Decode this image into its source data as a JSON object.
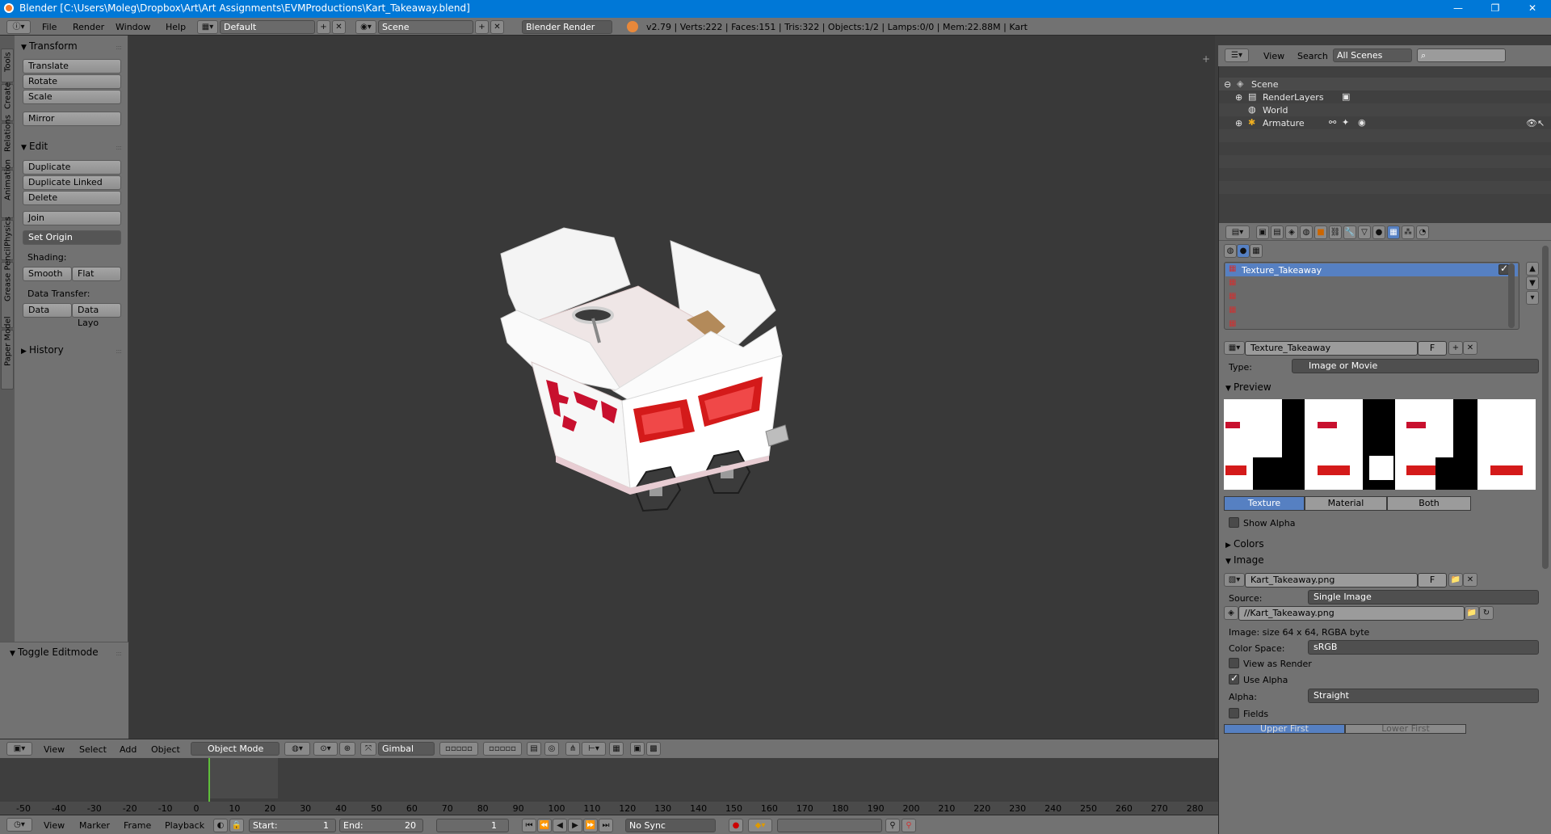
{
  "window": {
    "title": "Blender [C:\\Users\\Moleg\\Dropbox\\Art\\Art Assignments\\EVMProductions\\Kart_Takeaway.blend]",
    "minimize": "—",
    "maximize": "❐",
    "close": "✕"
  },
  "info_header": {
    "menus": [
      "File",
      "Render",
      "Window",
      "Help"
    ],
    "layout": "Default",
    "scene": "Scene",
    "engine": "Blender Render",
    "stats": "v2.79 | Verts:222 | Faces:151 | Tris:322 | Objects:1/2 | Lamps:0/0 | Mem:22.88M | Kart"
  },
  "tool_tabs": [
    "Tools",
    "Create",
    "Relations",
    "Animation",
    "Physics",
    "Grease Pencil",
    "Paper Model"
  ],
  "tool_shelf": {
    "transform_header": "Transform",
    "translate": "Translate",
    "rotate": "Rotate",
    "scale": "Scale",
    "mirror": "Mirror",
    "edit_header": "Edit",
    "duplicate": "Duplicate",
    "duplicate_linked": "Duplicate Linked",
    "delete": "Delete",
    "join": "Join",
    "set_origin": "Set Origin",
    "shading_label": "Shading:",
    "smooth": "Smooth",
    "flat": "Flat",
    "data_transfer_label": "Data Transfer:",
    "data": "Data",
    "data_layout": "Data Layo",
    "history_header": "History",
    "toggle_editmode": "Toggle Editmode"
  },
  "viewport_header": {
    "menus": [
      "View",
      "Select",
      "Add",
      "Object"
    ],
    "mode": "Object Mode",
    "orientation": "Gimbal"
  },
  "timeline": {
    "ticks": [
      "-50",
      "-40",
      "-30",
      "-20",
      "-10",
      "0",
      "10",
      "20",
      "30",
      "40",
      "50",
      "60",
      "70",
      "80",
      "90",
      "100",
      "110",
      "120",
      "130",
      "140",
      "150",
      "160",
      "170",
      "180",
      "190",
      "200",
      "210",
      "220",
      "230",
      "240",
      "250",
      "260",
      "270",
      "280"
    ],
    "current_frame": 0
  },
  "timeline_header": {
    "menus": [
      "View",
      "Marker",
      "Frame",
      "Playback"
    ],
    "start_label": "Start:",
    "start_value": "1",
    "end_label": "End:",
    "end_value": "20",
    "current": "1",
    "sync": "No Sync"
  },
  "outliner": {
    "menus": [
      "View",
      "Search"
    ],
    "filter": "All Scenes",
    "items": [
      {
        "label": "Scene"
      },
      {
        "label": "RenderLayers"
      },
      {
        "label": "World"
      },
      {
        "label": "Armature"
      }
    ]
  },
  "properties": {
    "texture_slot_active": "Texture_Takeaway",
    "texture_name": "Texture_Takeaway",
    "type_label": "Type:",
    "type_value": "Image or Movie",
    "preview_header": "Preview",
    "preview_tabs": [
      "Texture",
      "Material",
      "Both"
    ],
    "show_alpha": "Show Alpha",
    "colors_header": "Colors",
    "image_header": "Image",
    "image_name": "Kart_Takeaway.png",
    "source_label": "Source:",
    "source_value": "Single Image",
    "filepath": "//Kart_Takeaway.png",
    "image_info": "Image: size 64 x 64, RGBA byte",
    "color_space_label": "Color Space:",
    "color_space_value": "sRGB",
    "view_as_render": "View as Render",
    "use_alpha": "Use Alpha",
    "alpha_label": "Alpha:",
    "alpha_value": "Straight",
    "fields": "Fields",
    "upper_first": "Upper First",
    "lower_first": "Lower First",
    "fake_user": "F"
  },
  "colors": {
    "accent": "#5680c2",
    "titlebar": "#0078d7",
    "panel": "#727272",
    "viewport": "#393939"
  }
}
